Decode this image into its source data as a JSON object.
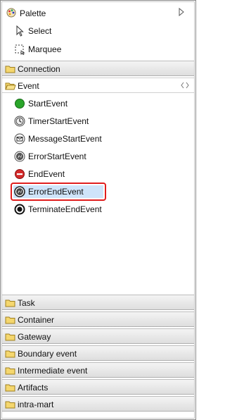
{
  "palette": {
    "title": "Palette",
    "tools": [
      {
        "label": "Select",
        "icon": "pointer-arrow-icon"
      },
      {
        "label": "Marquee",
        "icon": "marquee-icon"
      }
    ],
    "drawers_top": [
      {
        "label": "Connection",
        "open": false
      },
      {
        "label": "Event",
        "open": true
      }
    ],
    "event_items": [
      {
        "label": "StartEvent",
        "icon": "start-event-icon"
      },
      {
        "label": "TimerStartEvent",
        "icon": "timer-start-event-icon"
      },
      {
        "label": "MessageStartEvent",
        "icon": "message-start-event-icon"
      },
      {
        "label": "ErrorStartEvent",
        "icon": "error-start-event-icon"
      },
      {
        "label": "EndEvent",
        "icon": "end-event-icon"
      },
      {
        "label": "ErrorEndEvent",
        "icon": "error-end-event-icon",
        "selected": true
      },
      {
        "label": "TerminateEndEvent",
        "icon": "terminate-end-event-icon"
      }
    ],
    "drawers_bottom": [
      {
        "label": "Task"
      },
      {
        "label": "Container"
      },
      {
        "label": "Gateway"
      },
      {
        "label": "Boundary event"
      },
      {
        "label": "Intermediate event"
      },
      {
        "label": "Artifacts"
      },
      {
        "label": "intra-mart"
      }
    ],
    "colors": {
      "selection_highlight": "#cfe4fa",
      "selection_outline": "#e01e1e",
      "start_event_green": "#2aa52a",
      "end_event_red": "#d42a2a"
    }
  }
}
